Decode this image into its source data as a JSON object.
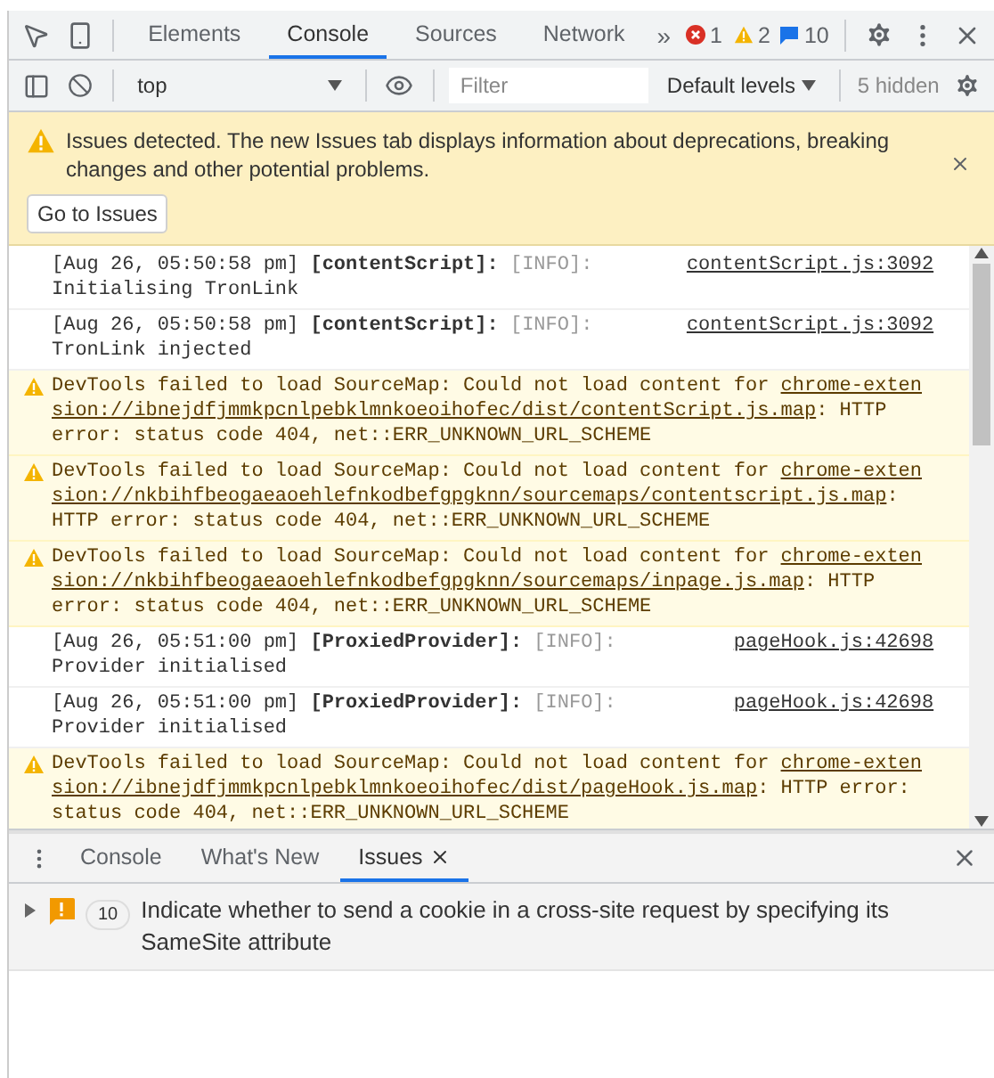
{
  "main_tabs": [
    {
      "label": "Elements",
      "selected": false
    },
    {
      "label": "Console",
      "selected": true
    },
    {
      "label": "Sources",
      "selected": false
    },
    {
      "label": "Network",
      "selected": false
    }
  ],
  "more_tabs": "»",
  "counters": {
    "errors": "1",
    "warnings": "2",
    "messages": "10"
  },
  "console_toolbar": {
    "context": "top",
    "filter_placeholder": "Filter",
    "levels": "Default levels",
    "hidden": "5 hidden"
  },
  "banner": {
    "text": "Issues detected. The new Issues tab displays information about deprecations, breaking changes and other potential problems.",
    "button": "Go to Issues"
  },
  "messages": [
    {
      "kind": "info",
      "timestamp": "[Aug 26, 05:50:58 pm]",
      "tag": "[contentScript]:",
      "level_label": "[INFO]:",
      "source": "contentScript.js:3092",
      "message": "Initialising TronLink"
    },
    {
      "kind": "info",
      "timestamp": "[Aug 26, 05:50:58 pm]",
      "tag": "[contentScript]:",
      "level_label": "[INFO]:",
      "source": "contentScript.js:3092",
      "message": "TronLink injected"
    },
    {
      "kind": "warning",
      "before": "DevTools failed to load SourceMap: Could not load content for ",
      "link_start": "chrome-exten",
      "link_rest": "sion://ibnejdfjmmkpcnlpebklmnkoeoihofec/dist/contentScript.js.map",
      "after": ": HTTP error: status code 404, net::ERR_UNKNOWN_URL_SCHEME"
    },
    {
      "kind": "warning",
      "before": "DevTools failed to load SourceMap: Could not load content for ",
      "link_start": "chrome-exten",
      "link_rest": "sion://nkbihfbeogaeaoehlefnkodbefgpgknn/sourcemaps/contentscript.js.map",
      "after": ": HTTP error: status code 404, net::ERR_UNKNOWN_URL_SCHEME"
    },
    {
      "kind": "warning",
      "before": "DevTools failed to load SourceMap: Could not load content for ",
      "link_start": "chrome-exten",
      "link_rest": "sion://nkbihfbeogaeaoehlefnkodbefgpgknn/sourcemaps/inpage.js.map",
      "after": ": HTTP error: status code 404, net::ERR_UNKNOWN_URL_SCHEME"
    },
    {
      "kind": "info",
      "timestamp": "[Aug 26, 05:51:00 pm]",
      "tag": "[ProxiedProvider]:",
      "level_label": "[INFO]:",
      "source": "pageHook.js:42698",
      "message": "Provider initialised"
    },
    {
      "kind": "info",
      "timestamp": "[Aug 26, 05:51:00 pm]",
      "tag": "[ProxiedProvider]:",
      "level_label": "[INFO]:",
      "source": "pageHook.js:42698",
      "message": "Provider initialised"
    },
    {
      "kind": "warning",
      "before": "DevTools failed to load SourceMap: Could not load content for ",
      "link_start": "chrome-exten",
      "link_rest": "sion://ibnejdfjmmkpcnlpebklmnkoeoihofec/dist/pageHook.js.map",
      "after": ": HTTP error: status code 404, net::ERR_UNKNOWN_URL_SCHEME"
    }
  ],
  "drawer_tabs": [
    {
      "label": "Console",
      "selected": false,
      "closable": false
    },
    {
      "label": "What's New",
      "selected": false,
      "closable": false
    },
    {
      "label": "Issues",
      "selected": true,
      "closable": true
    }
  ],
  "issues": [
    {
      "count": "10",
      "text": "Indicate whether to send a cookie in a cross-site request by specifying its SameSite attribute",
      "expanded": false
    }
  ]
}
